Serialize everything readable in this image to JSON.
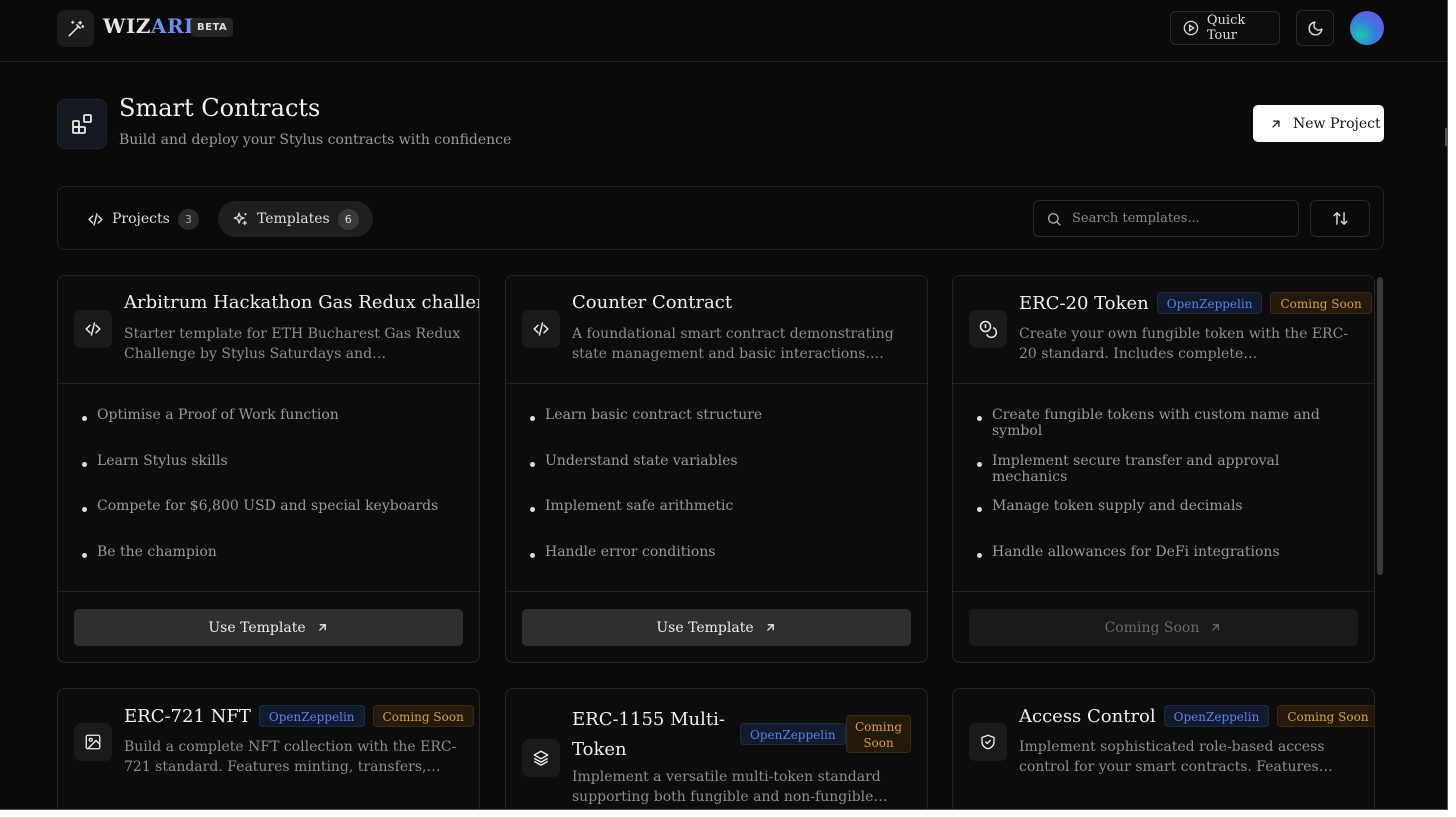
{
  "brand": {
    "name_part1": "WIZ",
    "name_part2": "ARD",
    "badge": "BETA"
  },
  "topbar": {
    "quick_tour": "Quick Tour"
  },
  "header": {
    "title": "Smart Contracts",
    "subtitle": "Build and deploy your Stylus contracts with confidence",
    "new_project": "New Project"
  },
  "tabs": [
    {
      "label": "Projects",
      "count": "3"
    },
    {
      "label": "Templates",
      "count": "6"
    }
  ],
  "search": {
    "placeholder": "Search templates..."
  },
  "cards": [
    {
      "title": "Arbitrum Hackathon Gas Redux challenge",
      "description": "Starter template for ETH Bucharest Gas Redux Challenge by Stylus Saturdays and Superposition",
      "features": [
        "Optimise a Proof of Work function",
        "Learn Stylus skills",
        "Compete for $6,800 USD and special keyboards",
        "Be the champion"
      ],
      "button": "Use Template"
    },
    {
      "title": "Counter Contract",
      "description": "A foundational smart contract demonstrating state management and basic interactions. Perfect starting point for learning Stylus.",
      "features": [
        "Learn basic contract structure",
        "Understand state variables",
        "Implement safe arithmetic",
        "Handle error conditions"
      ],
      "button": "Use Template"
    },
    {
      "title": "ERC-20 Token",
      "badge_oz": "OpenZeppelin",
      "badge_cs": "Coming Soon",
      "description": "Create your own fungible token with the ERC-20 standard. Includes complete implementation with transfer and approval.",
      "features": [
        "Create fungible tokens with custom name and symbol",
        "Implement secure transfer and approval mechanics",
        "Manage token supply and decimals",
        "Handle allowances for DeFi integrations"
      ],
      "button": "Coming Soon"
    },
    {
      "title": "ERC-721 NFT",
      "badge_oz": "OpenZeppelin",
      "badge_cs": "Coming Soon",
      "description": "Build a complete NFT collection with the ERC-721 standard. Features minting, transfers, metadata and more."
    },
    {
      "title_line1": "ERC-1155 Multi-",
      "title_line2": "Token",
      "badge_oz": "OpenZeppelin",
      "badge_cs_line1": "Coming",
      "badge_cs_line2": "Soon",
      "description": "Implement a versatile multi-token standard supporting both fungible and non-fungible tokens."
    },
    {
      "title": "Access Control",
      "badge_oz": "OpenZeppelin",
      "badge_cs": "Coming Soon",
      "description": "Implement sophisticated role-based access control for your smart contracts. Features flexible permission system."
    }
  ],
  "colors": {
    "accent_blue": "#5a84e8",
    "coming_soon": "#d8a13c",
    "background": "#0a0a0a"
  }
}
